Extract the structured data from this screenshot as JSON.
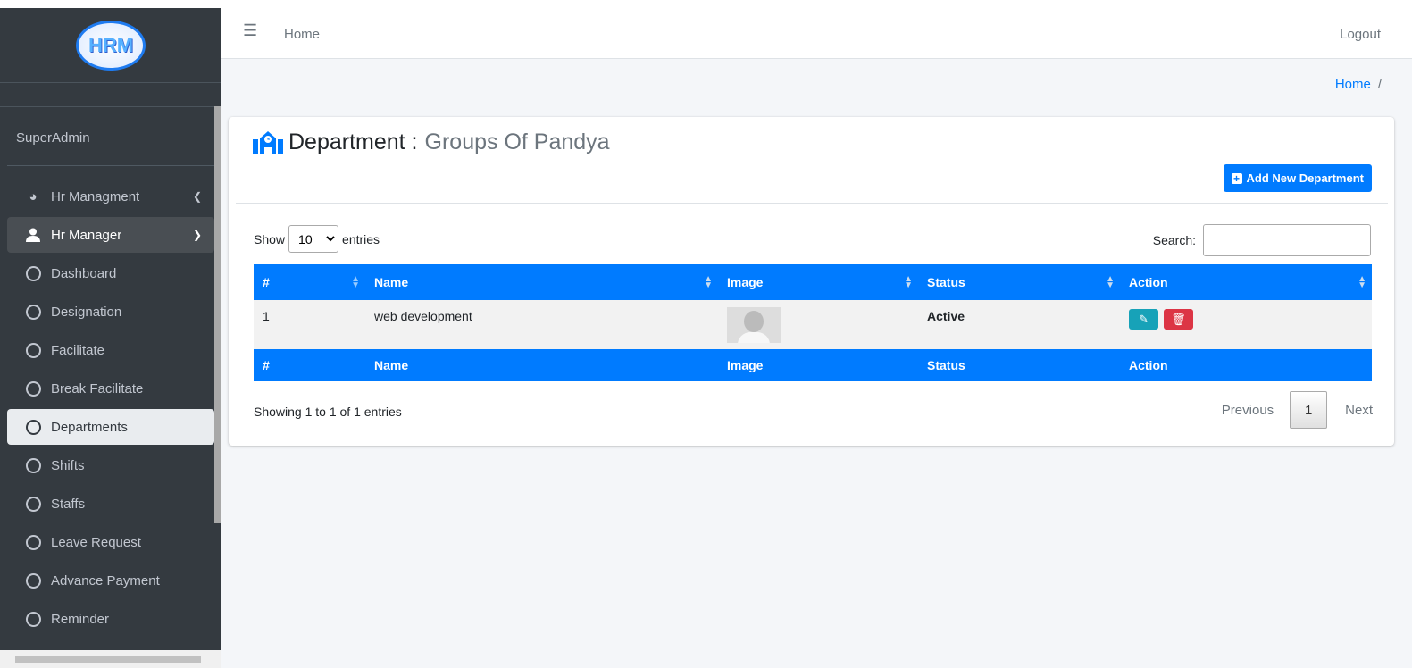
{
  "header": {
    "nav_home": "Home",
    "logout": "Logout"
  },
  "breadcrumb": {
    "home": "Home",
    "sep": "/"
  },
  "sidebar": {
    "logo_text": "HRM",
    "user": "SuperAdmin",
    "groups": [
      {
        "label": "Hr Managment",
        "icon": "tachometer-icon"
      },
      {
        "label": "Hr Manager",
        "icon": "user-icon"
      }
    ],
    "items": [
      "Dashboard",
      "Designation",
      "Facilitate",
      "Break Facilitate",
      "Departments",
      "Shifts",
      "Staffs",
      "Leave Request",
      "Advance Payment",
      "Reminder"
    ],
    "active": "Departments"
  },
  "page": {
    "title": "Department :",
    "subtitle": "Groups Of Pandya",
    "add_button": "Add New Department"
  },
  "table": {
    "show_label": "Show",
    "entries_label": "entries",
    "page_length": "10",
    "search_label": "Search:",
    "columns": [
      "#",
      "Name",
      "Image",
      "Status",
      "Action"
    ],
    "rows": [
      {
        "num": "1",
        "name": "web development",
        "status": "Active"
      }
    ],
    "info": "Showing 1 to 1 of 1 entries",
    "pagination": {
      "previous": "Previous",
      "current": "1",
      "next": "Next"
    }
  },
  "colors": {
    "primary": "#007bff",
    "sidebar": "#343a40",
    "edit": "#17a2b8",
    "delete": "#dc3545"
  }
}
